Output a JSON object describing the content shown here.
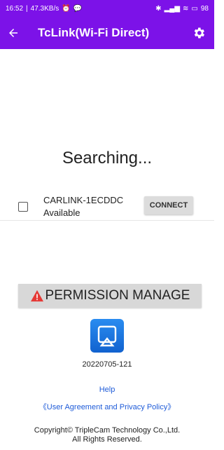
{
  "status_bar": {
    "time": "16:52",
    "speed": "47.3KB/s",
    "battery": "98"
  },
  "app_bar": {
    "title": "TcLink(Wi-Fi Direct)"
  },
  "main": {
    "searching_text": "Searching...",
    "device": {
      "name": "CARLINK-1ECDDC",
      "status": "Available",
      "connect_label": "CONNECT"
    },
    "permission_label": "PERMISSION MANAGE",
    "version": "20220705-121",
    "help_link": "Help",
    "policy_link": "《User Agreement and Privacy Policy》",
    "copyright_line1": "Copyright© TripleCam Technology Co.,Ltd.",
    "copyright_line2": "All Rights Reserved."
  },
  "colors": {
    "accent": "#7c12e8",
    "link": "#1e5bd8",
    "warning": "#e53935",
    "logo": "#1e7ae6"
  },
  "icons": [
    "back-arrow-icon",
    "gear-icon",
    "warning-icon",
    "app-logo-icon",
    "wifi-icon",
    "battery-icon",
    "bluetooth-icon",
    "signal-icon",
    "alarm-icon",
    "message-icon"
  ]
}
